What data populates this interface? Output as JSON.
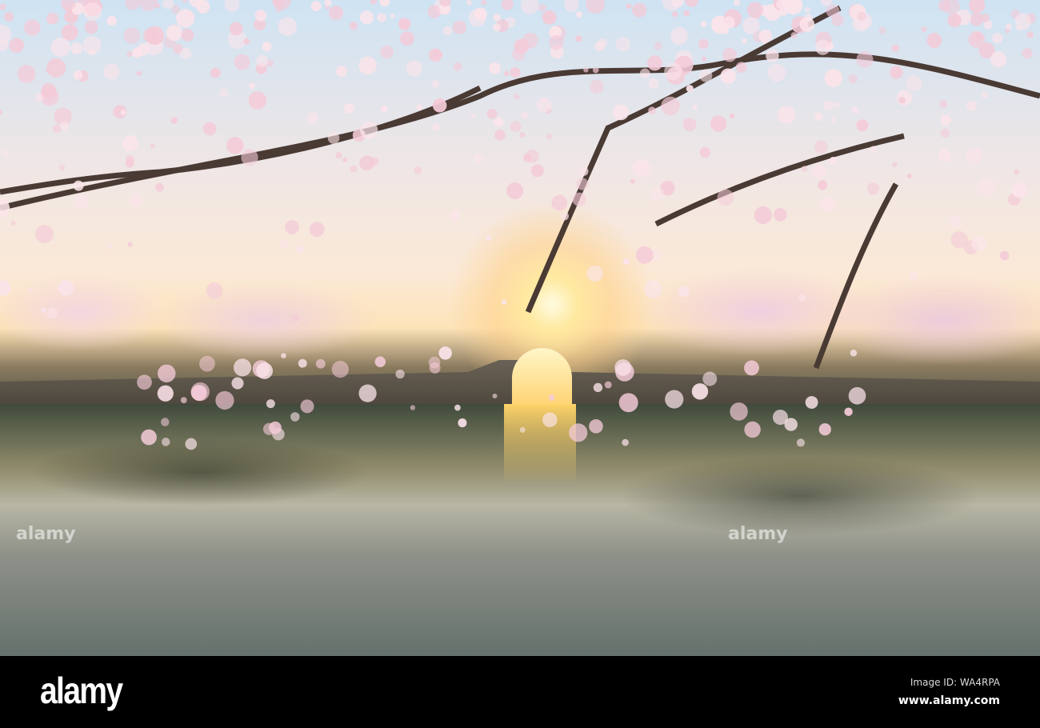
{
  "watermark": {
    "logo": "alamy",
    "image_id": "Image ID: WA4RPA",
    "url": "www.alamy.com",
    "overlay_text": "alamy"
  },
  "colors": {
    "blossom": "#f4cbd8",
    "branch": "#4a3a34",
    "sky": "#cfe3f3",
    "sun": "#ffe9a0",
    "bar": "#000000"
  }
}
